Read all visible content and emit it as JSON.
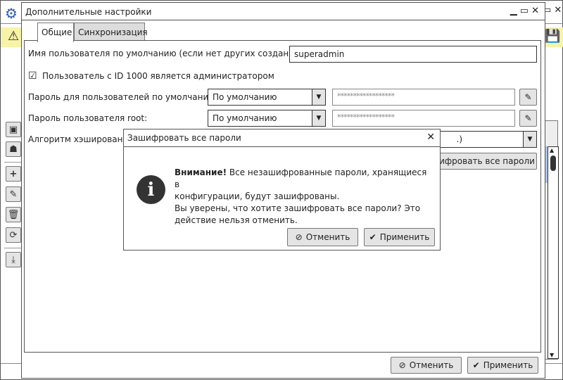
{
  "dialog": {
    "title": "Дополнительные настройки",
    "tabs": [
      {
        "label": "Общие",
        "active": true
      },
      {
        "label": "Синхронизация",
        "active": false
      }
    ]
  },
  "form": {
    "default_user_label": "Имя пользователя по умолчанию (если нет других созданных):",
    "default_user_value": "superadmin",
    "admin_checkbox_label": "Пользователь с ID 1000 является администратором",
    "admin_checked": true,
    "default_password_label": "Пароль для пользователей по умолчанию:",
    "default_password_mode": "По умолчанию",
    "default_password_value": "******************",
    "root_password_label": "Пароль пользователя root:",
    "root_password_mode": "По умолчанию",
    "root_password_value": "******************",
    "hash_label": "Алгоритм хэширования",
    "hash_value_tail": ".)",
    "encrypt_all_button": "Зашифровать все пароли"
  },
  "footer": {
    "cancel": "Отменить",
    "apply": "Применить"
  },
  "modal": {
    "title": "Зашифровать все пароли",
    "bold": "Внимание!",
    "line1": " Все незашифрованные пароли, хранящиеся в",
    "line2": "конфигурации, будут зашифрованы.",
    "line3": "Вы уверены, что хотите зашифровать все пароли? Это",
    "line4": "действие нельзя отменить.",
    "cancel": "Отменить",
    "apply": "Применить"
  }
}
